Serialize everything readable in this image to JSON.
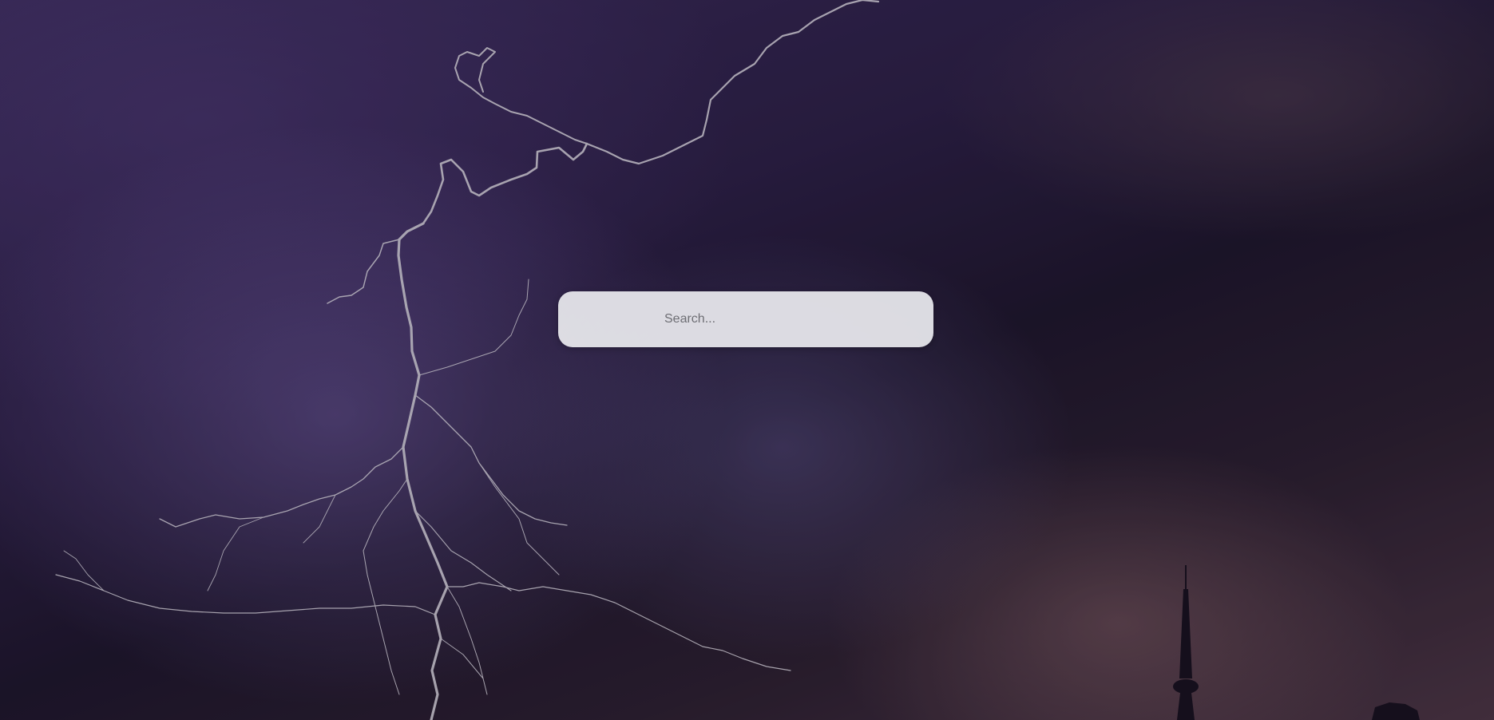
{
  "background": {
    "image": "night-sky-lightning-with-tower",
    "accent": "#2a1f42"
  },
  "search": {
    "placeholder": "Search...",
    "value": ""
  }
}
